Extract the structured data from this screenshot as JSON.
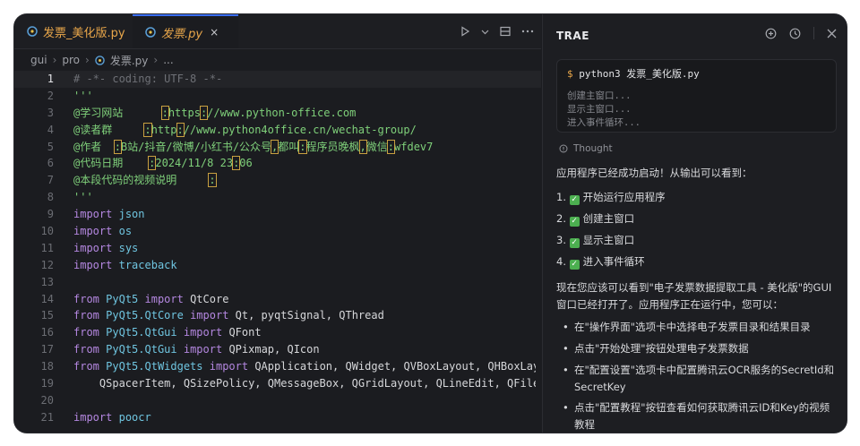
{
  "tabs": [
    {
      "label": "发票_美化版.py"
    },
    {
      "label": "发票.py",
      "close": "×"
    }
  ],
  "breadcrumb": [
    "gui",
    "pro",
    "发票.py",
    "..."
  ],
  "code_lines": [
    {
      "n": "1",
      "t": "# -*- coding: UTF-8 -*-"
    },
    {
      "n": "2",
      "t": "'''"
    },
    {
      "n": "3",
      "t": "@学习网站      :https://www.python-office.com"
    },
    {
      "n": "4",
      "t": "@读者群     :http://www.python4office.cn/wechat-group/"
    },
    {
      "n": "5",
      "t": "@作者  :B站/抖音/微博/小红书/公众号,都叫:程序员晚枫,微信:wfdev7"
    },
    {
      "n": "6",
      "t": "@代码日期    :2024/11/8 23:06"
    },
    {
      "n": "7",
      "t": "@本段代码的视频说明     :"
    },
    {
      "n": "8",
      "t": "'''"
    },
    {
      "n": "9",
      "t": "import json"
    },
    {
      "n": "10",
      "t": "import os"
    },
    {
      "n": "11",
      "t": "import sys"
    },
    {
      "n": "12",
      "t": "import traceback"
    },
    {
      "n": "13",
      "t": ""
    },
    {
      "n": "14",
      "t": "from PyQt5 import QtCore"
    },
    {
      "n": "15",
      "t": "from PyQt5.QtCore import Qt, pyqtSignal, QThread"
    },
    {
      "n": "16",
      "t": "from PyQt5.QtGui import QFont"
    },
    {
      "n": "17",
      "t": "from PyQt5.QtGui import QPixmap, QIcon"
    },
    {
      "n": "18",
      "t": "from PyQt5.QtWidgets import QApplication, QWidget, QVBoxLayout, QHBoxLayout, Q"
    },
    {
      "n": "19",
      "t": "    QSpacerItem, QSizePolicy, QMessageBox, QGridLayout, QLineEdit, QFileDialog"
    },
    {
      "n": "20",
      "t": ""
    },
    {
      "n": "21",
      "t": "import poocr"
    }
  ],
  "panel": {
    "title": "TRAE",
    "terminal": {
      "prompt": "$",
      "command": "python3 发票_美化版.py",
      "output": [
        "创建主窗口...",
        "显示主窗口...",
        "进入事件循环..."
      ]
    },
    "thought_label": "Thought",
    "intro": "应用程序已经成功启动！从输出可以看到：",
    "steps": [
      "开始运行应用程序",
      "创建主窗口",
      "显示主窗口",
      "进入事件循环"
    ],
    "para": "现在您应该可以看到\"电子发票数据提取工具 - 美化版\"的GUI窗口已经打开了。应用程序正在运行中，您可以：",
    "bullets": [
      "在\"操作界面\"选项卡中选择电子发票目录和结果目录",
      "点击\"开始处理\"按钮处理电子发票数据",
      "在\"配置设置\"选项卡中配置腾讯云OCR服务的SecretId和SecretKey",
      "点击\"配置教程\"按钮查看如何获取腾讯云ID和Key的视频教程"
    ]
  },
  "colors": {
    "accent": "#3a6df0",
    "warning_box": "#c8a040",
    "string": "#7fd07a",
    "keyword": "#b487e0"
  }
}
